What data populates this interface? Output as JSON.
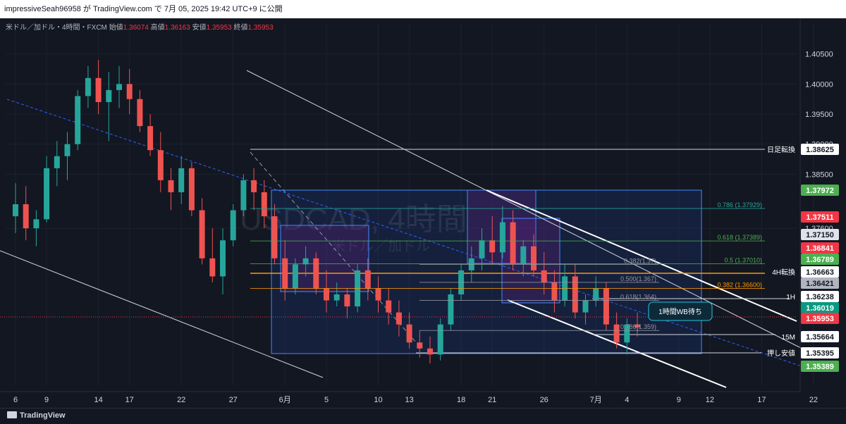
{
  "header": {
    "text": "impressiveSeah96958 が TradingView.com で 7月 05, 2025 19:42 UTC+9 に公開"
  },
  "legend": {
    "symbol": "米ドル／加ドル・4時間・FXCM",
    "open_label": "始値",
    "open": "1.36074",
    "high_label": "高値",
    "high": "1.36163",
    "low_label": "安値",
    "low": "1.35953",
    "close_label": "終値",
    "close": "1.35953"
  },
  "watermark": {
    "title": "USDCAD, 4時間",
    "subtitle": "米ドル／加ドル"
  },
  "footer": {
    "brand": "TradingView"
  },
  "colors": {
    "background": "#131722",
    "up": "#26a69a",
    "down": "#ef5350",
    "fib_green": "#4caf50",
    "fib_orange": "#ff9800",
    "box_blue": "#2962ff"
  },
  "chart_data": {
    "type": "candlestick",
    "instrument": "USDCAD",
    "timeframe": "4H",
    "ylim": [
      1.35,
      1.41
    ],
    "y_ticks": [
      {
        "value": 1.405,
        "label": "1.40500"
      },
      {
        "value": 1.4,
        "label": "1.40000"
      },
      {
        "value": 1.395,
        "label": "1.39500"
      },
      {
        "value": 1.39,
        "label": "1.39000"
      },
      {
        "value": 1.385,
        "label": "1.38500"
      },
      {
        "value": 1.376,
        "label": "1.37600"
      }
    ],
    "x_ticks": [
      {
        "pos": 0.0,
        "label": "6"
      },
      {
        "pos": 3.0,
        "label": "9"
      },
      {
        "pos": 8.0,
        "label": "14"
      },
      {
        "pos": 11.0,
        "label": "17"
      },
      {
        "pos": 16.0,
        "label": "22"
      },
      {
        "pos": 21.0,
        "label": "27"
      },
      {
        "pos": 26.0,
        "label": "6月"
      },
      {
        "pos": 30.0,
        "label": "5"
      },
      {
        "pos": 35.0,
        "label": "10"
      },
      {
        "pos": 38.0,
        "label": "13"
      },
      {
        "pos": 43.0,
        "label": "18"
      },
      {
        "pos": 46.0,
        "label": "21"
      },
      {
        "pos": 51.0,
        "label": "26"
      },
      {
        "pos": 56.0,
        "label": "7月"
      },
      {
        "pos": 59.0,
        "label": "4"
      },
      {
        "pos": 64.0,
        "label": "9"
      },
      {
        "pos": 67.0,
        "label": "12"
      },
      {
        "pos": 72.0,
        "label": "17"
      },
      {
        "pos": 77.0,
        "label": "22"
      }
    ],
    "price_tags": [
      {
        "value": 1.38625,
        "label": "1.38625",
        "bg": "#ffffff",
        "fg": "#131722",
        "note": "日足転換"
      },
      {
        "value": 1.37972,
        "label": "1.37972",
        "bg": "#4caf50",
        "fg": "#ffffff",
        "note": ""
      },
      {
        "value": 1.37511,
        "label": "1.37511",
        "bg": "#f23645",
        "fg": "#ffffff",
        "note": ""
      },
      {
        "value": 1.3715,
        "label": "1.37150",
        "bg": "#e0e3eb",
        "fg": "#131722",
        "note": ""
      },
      {
        "value": 1.36841,
        "label": "1.36841",
        "bg": "#f23645",
        "fg": "#ffffff",
        "note": ""
      },
      {
        "value": 1.36789,
        "label": "1.36789",
        "bg": "#4caf50",
        "fg": "#ffffff",
        "note": ""
      },
      {
        "value": 1.36663,
        "label": "1.36663",
        "bg": "#ffffff",
        "fg": "#131722",
        "note": "4H転換"
      },
      {
        "value": 1.36421,
        "label": "1.36421",
        "bg": "#b2b5be",
        "fg": "#131722",
        "note": ""
      },
      {
        "value": 1.36238,
        "label": "1.36238",
        "bg": "#ffffff",
        "fg": "#131722",
        "note": "1H"
      },
      {
        "value": 1.36019,
        "label": "1.36019",
        "bg": "#089981",
        "fg": "#ffffff",
        "note": ""
      },
      {
        "value": 1.35953,
        "label": "1.35953",
        "bg": "#f23645",
        "fg": "#ffffff",
        "note": ""
      },
      {
        "value": 1.35664,
        "label": "1.35664",
        "bg": "#ffffff",
        "fg": "#131722",
        "note": "15M"
      },
      {
        "value": 1.35395,
        "label": "1.35395",
        "bg": "#ffffff",
        "fg": "#131722",
        "note": "押し安値"
      },
      {
        "value": 1.35389,
        "label": "1.35389",
        "bg": "#4caf50",
        "fg": "#ffffff",
        "note": ""
      }
    ],
    "fib_levels": [
      {
        "value": 1.37929,
        "label": "0.786 (1.37929)",
        "color": "#26a69a"
      },
      {
        "value": 1.37389,
        "label": "0.618 (1.37389)",
        "color": "#4caf50"
      },
      {
        "value": 1.3701,
        "label": "0.5 (1.37010)",
        "color": "#4caf50"
      },
      {
        "value": 1.366,
        "label": "0.382 (1.36600)",
        "color": "#ff9800"
      },
      {
        "value": 1.37,
        "label": "0.382(1.37)",
        "color": "#9598a1"
      },
      {
        "value": 1.367,
        "label": "0.500(1.367)",
        "color": "#9598a1"
      },
      {
        "value": 1.364,
        "label": "0.618(1.364)",
        "color": "#9598a1"
      },
      {
        "value": 1.359,
        "label": "0.786(1.359)",
        "color": "#9598a1"
      }
    ],
    "annotations": [
      {
        "text": "1時間WB待ち"
      }
    ],
    "series": [
      {
        "ohlc": [
          [
            1.378,
            1.3835,
            1.3752,
            1.38
          ],
          [
            1.38,
            1.383,
            1.374,
            1.376
          ],
          [
            1.376,
            1.379,
            1.373,
            1.3775
          ],
          [
            1.3775,
            1.388,
            1.377,
            1.386
          ],
          [
            1.386,
            1.3905,
            1.383,
            1.388
          ],
          [
            1.388,
            1.392,
            1.384,
            1.39
          ],
          [
            1.39,
            1.399,
            1.389,
            1.398
          ],
          [
            1.398,
            1.403,
            1.396,
            1.401
          ],
          [
            1.401,
            1.404,
            1.395,
            1.397
          ],
          [
            1.397,
            1.402,
            1.3905,
            1.399
          ],
          [
            1.399,
            1.403,
            1.396,
            1.4
          ],
          [
            1.4,
            1.4025,
            1.395,
            1.3975
          ],
          [
            1.3975,
            1.399,
            1.392,
            1.393
          ],
          [
            1.393,
            1.395,
            1.388,
            1.389
          ],
          [
            1.389,
            1.392,
            1.382,
            1.384
          ],
          [
            1.384,
            1.386,
            1.379,
            1.382
          ],
          [
            1.382,
            1.388,
            1.38,
            1.386
          ],
          [
            1.386,
            1.387,
            1.378,
            1.379
          ],
          [
            1.379,
            1.381,
            1.37,
            1.371
          ],
          [
            1.371,
            1.376,
            1.367,
            1.368
          ],
          [
            1.368,
            1.376,
            1.365,
            1.374
          ],
          [
            1.374,
            1.38,
            1.373,
            1.379
          ],
          [
            1.379,
            1.385,
            1.378,
            1.384
          ],
          [
            1.384,
            1.386,
            1.379,
            1.382
          ],
          [
            1.382,
            1.384,
            1.376,
            1.378
          ],
          [
            1.378,
            1.38,
            1.37,
            1.371
          ],
          [
            1.371,
            1.374,
            1.364,
            1.366
          ],
          [
            1.366,
            1.371,
            1.365,
            1.37
          ],
          [
            1.37,
            1.373,
            1.368,
            1.371
          ],
          [
            1.371,
            1.372,
            1.365,
            1.366
          ],
          [
            1.366,
            1.369,
            1.362,
            1.364
          ],
          [
            1.364,
            1.367,
            1.363,
            1.365
          ],
          [
            1.365,
            1.366,
            1.361,
            1.363
          ],
          [
            1.363,
            1.37,
            1.362,
            1.369
          ],
          [
            1.369,
            1.371,
            1.364,
            1.366
          ],
          [
            1.366,
            1.368,
            1.362,
            1.364
          ],
          [
            1.364,
            1.366,
            1.36,
            1.362
          ],
          [
            1.362,
            1.364,
            1.358,
            1.36
          ],
          [
            1.36,
            1.362,
            1.356,
            1.357
          ],
          [
            1.357,
            1.359,
            1.3545,
            1.356
          ],
          [
            1.356,
            1.358,
            1.3535,
            1.355
          ],
          [
            1.355,
            1.361,
            1.354,
            1.36
          ],
          [
            1.36,
            1.366,
            1.359,
            1.365
          ],
          [
            1.365,
            1.37,
            1.364,
            1.369
          ],
          [
            1.369,
            1.373,
            1.367,
            1.371
          ],
          [
            1.371,
            1.376,
            1.369,
            1.374
          ],
          [
            1.374,
            1.378,
            1.37,
            1.372
          ],
          [
            1.372,
            1.3797,
            1.371,
            1.377
          ],
          [
            1.377,
            1.379,
            1.369,
            1.37
          ],
          [
            1.37,
            1.374,
            1.368,
            1.373
          ],
          [
            1.373,
            1.375,
            1.368,
            1.369
          ],
          [
            1.369,
            1.372,
            1.365,
            1.367
          ],
          [
            1.367,
            1.369,
            1.362,
            1.364
          ],
          [
            1.364,
            1.37,
            1.363,
            1.368
          ],
          [
            1.368,
            1.37,
            1.361,
            1.362
          ],
          [
            1.362,
            1.365,
            1.36,
            1.364
          ],
          [
            1.364,
            1.368,
            1.363,
            1.366
          ],
          [
            1.366,
            1.367,
            1.359,
            1.36
          ],
          [
            1.36,
            1.362,
            1.356,
            1.357
          ],
          [
            1.357,
            1.361,
            1.355,
            1.36
          ],
          [
            1.36,
            1.362,
            1.358,
            1.3595
          ]
        ]
      }
    ]
  }
}
